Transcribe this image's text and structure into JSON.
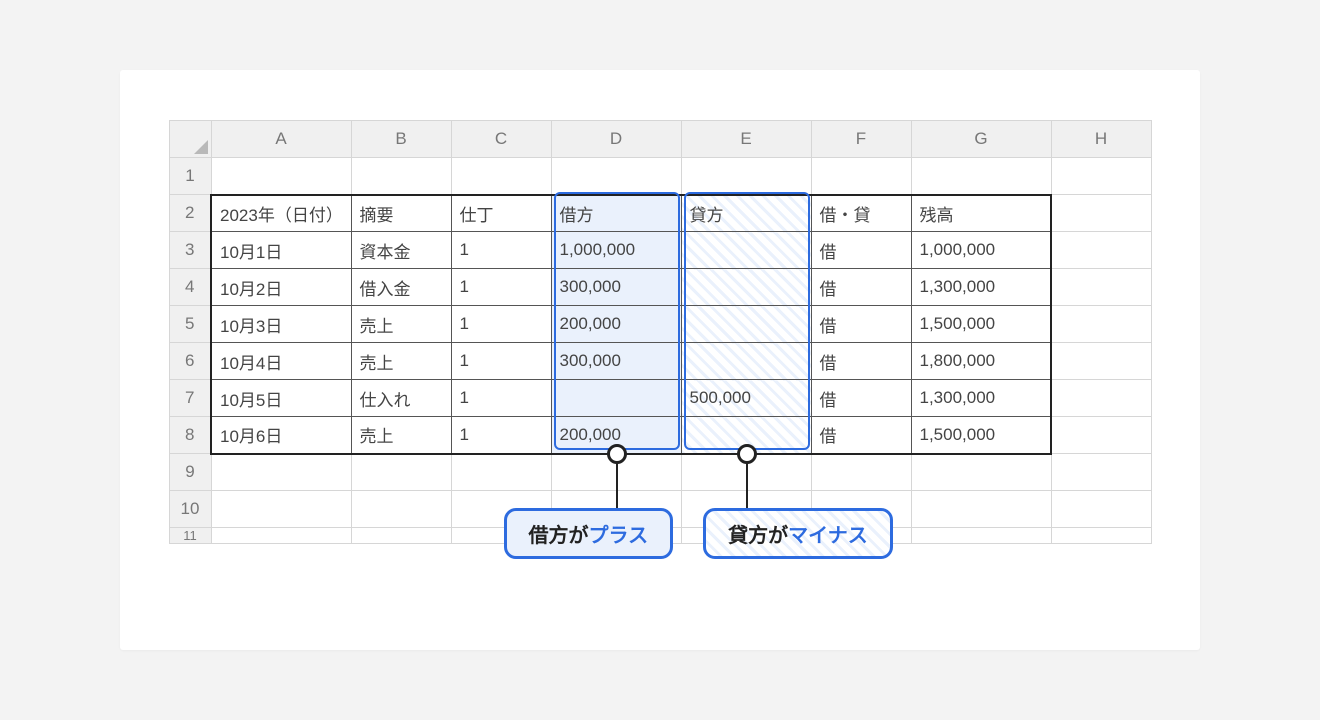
{
  "columns": [
    "A",
    "B",
    "C",
    "D",
    "E",
    "F",
    "G",
    "H"
  ],
  "rowNumbers": [
    "1",
    "2",
    "3",
    "4",
    "5",
    "6",
    "7",
    "8",
    "9",
    "10",
    "11"
  ],
  "headers": {
    "date": "2023年（日付）",
    "summary": "摘要",
    "ref": "仕丁",
    "debit": "借方",
    "credit": "貸方",
    "drcr": "借・貸",
    "balance": "残高"
  },
  "rows": [
    {
      "date": "10月1日",
      "summary": "資本金",
      "ref": "1",
      "debit": "1,000,000",
      "credit": "",
      "drcr": "借",
      "balance": "1,000,000"
    },
    {
      "date": "10月2日",
      "summary": "借入金",
      "ref": "1",
      "debit": "300,000",
      "credit": "",
      "drcr": "借",
      "balance": "1,300,000"
    },
    {
      "date": "10月3日",
      "summary": "売上",
      "ref": "1",
      "debit": "200,000",
      "credit": "",
      "drcr": "借",
      "balance": "1,500,000"
    },
    {
      "date": "10月4日",
      "summary": "売上",
      "ref": "1",
      "debit": "300,000",
      "credit": "",
      "drcr": "借",
      "balance": "1,800,000"
    },
    {
      "date": "10月5日",
      "summary": "仕入れ",
      "ref": "1",
      "debit": "",
      "credit": "500,000",
      "drcr": "借",
      "balance": "1,300,000"
    },
    {
      "date": "10月6日",
      "summary": "売上",
      "ref": "1",
      "debit": "200,000",
      "credit": "",
      "drcr": "借",
      "balance": "1,500,000"
    }
  ],
  "callouts": {
    "debit_prefix": "借方が",
    "debit_accent": "プラス",
    "credit_prefix": "貸方が",
    "credit_accent": "マイナス"
  }
}
